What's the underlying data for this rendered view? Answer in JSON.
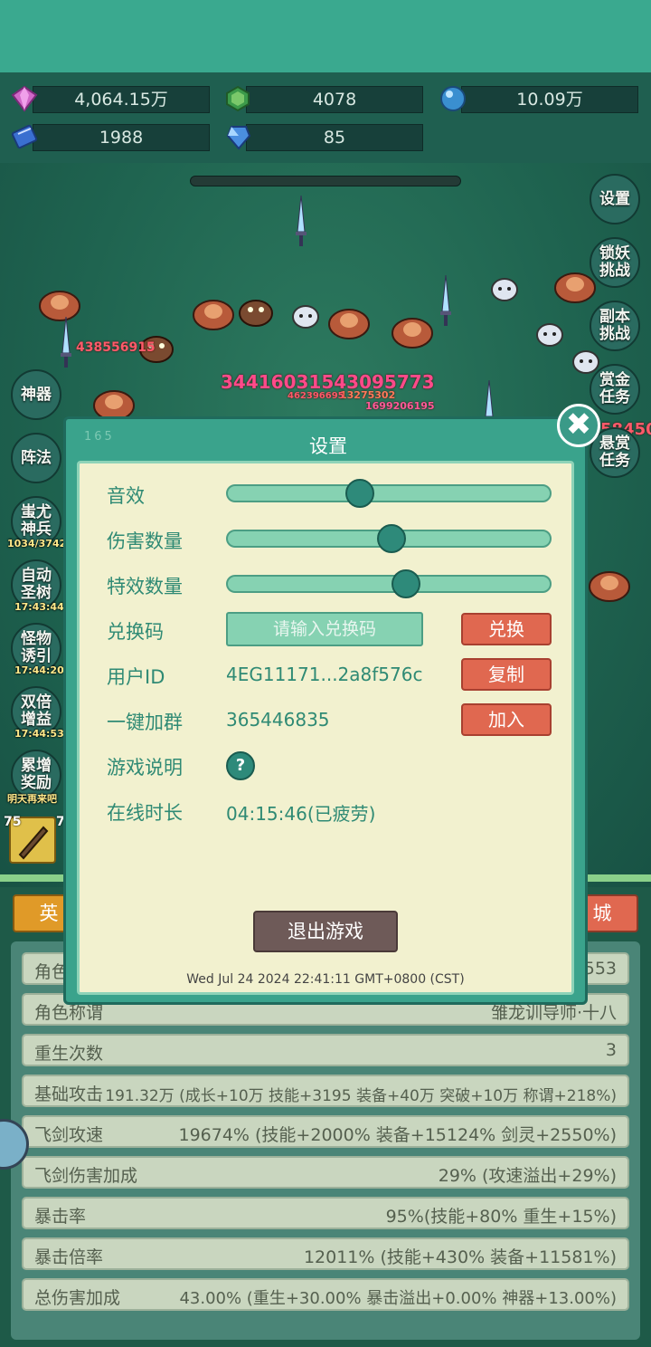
{
  "resources": {
    "gem": "4,064.15万",
    "jade": "4078",
    "orb": "10.09万",
    "book": "1988",
    "crystal": "85"
  },
  "right_buttons": [
    "设置",
    "锁妖\n挑战",
    "副本\n挑战",
    "赏金\n任务",
    "悬赏\n任务"
  ],
  "left_buttons": [
    {
      "label": "神器",
      "timer": ""
    },
    {
      "label": "阵法",
      "timer": ""
    },
    {
      "label": "蚩尤\n神兵",
      "timer": "1034/3742"
    },
    {
      "label": "自动\n圣树",
      "timer": "17:43:44"
    },
    {
      "label": "怪物\n诱引",
      "timer": "17:44:20"
    },
    {
      "label": "双倍\n增益",
      "timer": "17:44:53"
    },
    {
      "label": "累增\n奖励",
      "timer": "明天再来吧"
    }
  ],
  "damage_numbers": [
    "438556915",
    "34416031543095773",
    "1699206195",
    "13275302",
    "462396695",
    "58450"
  ],
  "bottom_tabs": {
    "left": "英",
    "right": "城"
  },
  "stats": [
    {
      "key": "角色",
      "value": "553"
    },
    {
      "key": "角色称谓",
      "value": "雏龙训导师·十八"
    },
    {
      "key": "重生次数",
      "value": "3"
    },
    {
      "key": "基础攻击",
      "value": "191.32万 (成长+10万 技能+3195 装备+40万 突破+10万 称谓+218%)"
    },
    {
      "key": "飞剑攻速",
      "value": "19674% (技能+2000% 装备+15124% 剑灵+2550%)"
    },
    {
      "key": "飞剑伤害加成",
      "value": "29% (攻速溢出+29%)"
    },
    {
      "key": "暴击率",
      "value": "95%(技能+80% 重生+15%)"
    },
    {
      "key": "暴击倍率",
      "value": "12011% (技能+430% 装备+11581%)"
    },
    {
      "key": "总伤害加成",
      "value": "43.00% (重生+30.00% 暴击溢出+0.00% 神器+13.00%)"
    }
  ],
  "dialog": {
    "num": "165",
    "title": "设置",
    "close": "✖",
    "sound_label": "音效",
    "sound_level": 0.4,
    "damage_label": "伤害数量",
    "damage_level": 0.51,
    "effect_label": "特效数量",
    "effect_level": 0.56,
    "redeem_label": "兑换码",
    "redeem_placeholder": "请输入兑换码",
    "redeem_button": "兑换",
    "uid_label": "用户ID",
    "uid_value": "4EG11171...2a8f576c",
    "copy_button": "复制",
    "group_label": "一键加群",
    "group_value": "365446835",
    "join_button": "加入",
    "help_label": "游戏说明",
    "help_icon": "?",
    "online_label": "在线时长",
    "online_value": "04:15:46(已疲劳)",
    "exit_button": "退出游戏",
    "datetime": "Wed Jul 24 2024 22:41:11 GMT+0800 (CST)"
  },
  "slot_levels": [
    "75",
    "7"
  ]
}
